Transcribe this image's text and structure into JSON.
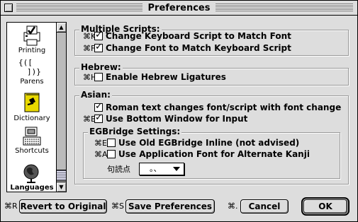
{
  "window": {
    "title": "Preferences"
  },
  "sidebar": {
    "items": [
      {
        "label": "Printing",
        "icon": "printer-check-icon"
      },
      {
        "label": "Parens",
        "icon": "parens-icon",
        "glyphs_top": "{([",
        "glyphs_bottom": "])}"
      },
      {
        "label": "Dictionary",
        "icon": "dictionary-book-icon"
      },
      {
        "label": "Shortcuts",
        "icon": "keyboard-shortcuts-icon"
      },
      {
        "label": "Languages",
        "icon": "globe-icon",
        "selected": true
      }
    ]
  },
  "groups": {
    "multiple_scripts": {
      "title": "Multiple Scripts:",
      "items": [
        {
          "shortcut": "⌘K",
          "label": "Change Keyboard Script to Match Font",
          "checked": true
        },
        {
          "shortcut": "⌘F",
          "label": "Change Font to Match Keyboard Script",
          "checked": true
        }
      ]
    },
    "hebrew": {
      "title": "Hebrew:",
      "items": [
        {
          "shortcut": "⌘H",
          "label": "Enable Hebrew Ligatures",
          "checked": false
        }
      ]
    },
    "asian": {
      "title": "Asian:",
      "items": [
        {
          "shortcut": "",
          "label": "Roman text changes font/script with font change",
          "checked": true
        },
        {
          "shortcut": "⌘B",
          "label": "Use Bottom Window for Input",
          "checked": true
        }
      ]
    },
    "egbridge": {
      "title": "EGBridge Settings:",
      "items": [
        {
          "shortcut": "⌘E",
          "label": "Use Old EGBridge Inline (not advised)",
          "checked": false
        },
        {
          "shortcut": "⌘A",
          "label": "Use Application Font for Alternate Kanji",
          "checked": false
        }
      ],
      "punct_label": "句読点",
      "punct_value": "。、"
    }
  },
  "buttons": {
    "revert": {
      "shortcut": "⌘R",
      "label": "Revert to Original"
    },
    "save": {
      "shortcut": "⌘S",
      "label": "Save Preferences"
    },
    "cancel": {
      "shortcut": "⌘.",
      "label": "Cancel"
    },
    "ok": {
      "label": "OK"
    }
  }
}
